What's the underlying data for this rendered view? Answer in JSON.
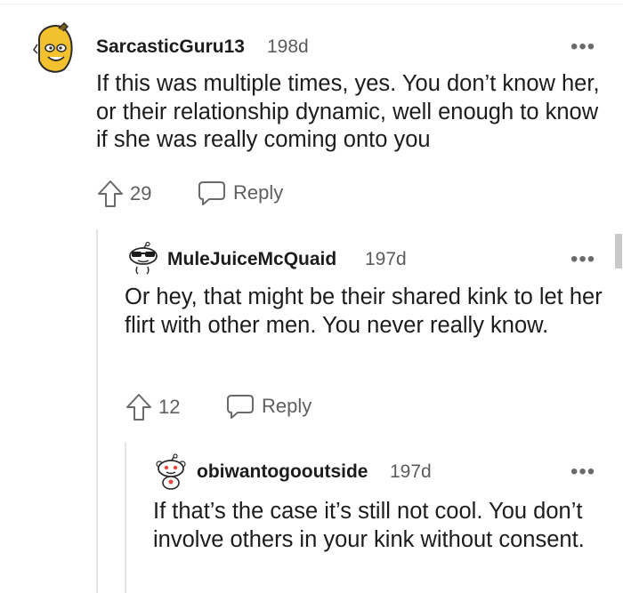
{
  "comments": [
    {
      "username": "SarcasticGuru13",
      "age": "198d",
      "more": "•••",
      "body": "If this was multiple times, yes. You don’t know her, or their relationship dynamic, well enough to know if she was really coming onto you",
      "votes": "29",
      "reply_label": "Reply",
      "avatar_icon": "banana-snoo-avatar-icon"
    },
    {
      "username": "MuleJuiceMcQuaid",
      "age": "197d",
      "more": "•••",
      "body": "Or hey, that might be their shared kink to let her flirt with other men. You never really know.",
      "votes": "12",
      "reply_label": "Reply",
      "avatar_icon": "sunglasses-snoo-avatar-icon"
    },
    {
      "username": "obiwantogooutside",
      "age": "197d",
      "more": "•••",
      "body": "If that’s the case it’s still not cool. You don’t involve others in your kink without consent.",
      "avatar_icon": "snoo-avatar-icon"
    }
  ],
  "colors": {
    "text": "#1c1c1c",
    "meta": "#5c5c5c",
    "thread_line": "#e4e4e4",
    "avatar_yellow": "#f2c12e"
  }
}
